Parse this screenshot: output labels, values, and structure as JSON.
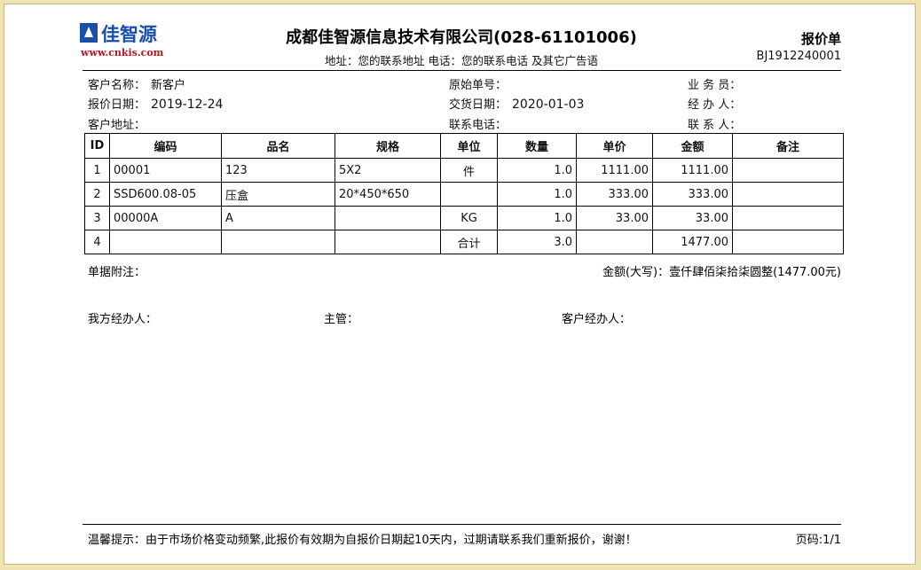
{
  "header": {
    "logo_text": "佳智源",
    "logo_url": "www.cnkis.com",
    "company": "成都佳智源信息技术有限公司(028-61101006)",
    "contact": "地址：您的联系地址   电话：您的联系电话  及其它广告语",
    "doc_type": "报价单",
    "doc_no": "BJ1912240001"
  },
  "info": {
    "customer_name_label": "客户名称：",
    "customer_name": "新客户",
    "quote_date_label": "报价日期：",
    "quote_date": "2019-12-24",
    "customer_addr_label": "客户地址：",
    "orig_no_label": "原始单号：",
    "delivery_date_label": "交货日期：",
    "delivery_date": "2020-01-03",
    "phone_label": "联系电话：",
    "salesman_label": "业 务 员：",
    "handler_label": "经 办 人：",
    "contact_label": "联 系 人："
  },
  "table": {
    "headers": [
      "ID",
      "编码",
      "品名",
      "规格",
      "单位",
      "数量",
      "单价",
      "金额",
      "备注"
    ],
    "rows": [
      [
        "1",
        "00001",
        "123",
        "5X2",
        "件",
        "1.0",
        "1111.00",
        "1111.00",
        ""
      ],
      [
        "2",
        "SSD600.08-05",
        "压盒",
        "20*450*650",
        "",
        "1.0",
        "333.00",
        "333.00",
        ""
      ],
      [
        "3",
        "00000A",
        "A",
        "",
        "KG",
        "1.0",
        "33.00",
        "33.00",
        ""
      ],
      [
        "4",
        "",
        "",
        "",
        "合计",
        "3.0",
        "",
        "1477.00",
        ""
      ]
    ]
  },
  "footer": {
    "remark_label": "单据附注：",
    "amount_words": "金额(大写)：壹仟肆佰柒拾柒圆整(1477.00元)",
    "our_handler": "我方经办人：",
    "supervisor": "主管：",
    "customer_handler": "客户经办人：",
    "tip": "温馨提示：由于市场价格变动频繁,此报价有效期为自报价日期起10天内，过期请联系我们重新报价，谢谢！",
    "page_no": "页码:1/1"
  }
}
